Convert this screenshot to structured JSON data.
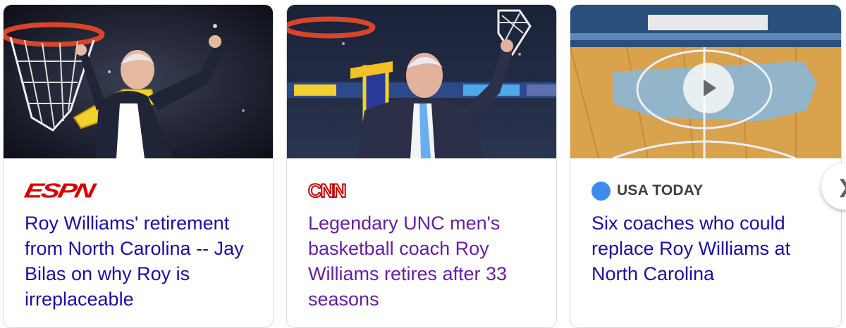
{
  "cards": [
    {
      "source": "ESPN",
      "source_logo": "espn-logo",
      "headline": "Roy Williams' retirement from North Carolina -- Jay Bilas on why Roy is irreplaceable",
      "visited": false
    },
    {
      "source": "CNN",
      "source_logo": "cnn-logo",
      "headline": "Legendary UNC men's basketball coach Roy Williams retires after 33 seasons",
      "visited": true
    },
    {
      "source": "USA TODAY",
      "source_logo": "usa-today-dot",
      "headline": "Six coaches who could replace Roy Williams at North Carolina",
      "visited": false,
      "has_video": true
    }
  ],
  "colors": {
    "link": "#1a0dab",
    "visited_link": "#681da8",
    "espn_red": "#dd0000",
    "cnn_red": "#cc0000",
    "usa_today_blue": "#3c8cf0"
  },
  "icons": {
    "play": "play-icon",
    "next": "chevron-right-icon"
  }
}
